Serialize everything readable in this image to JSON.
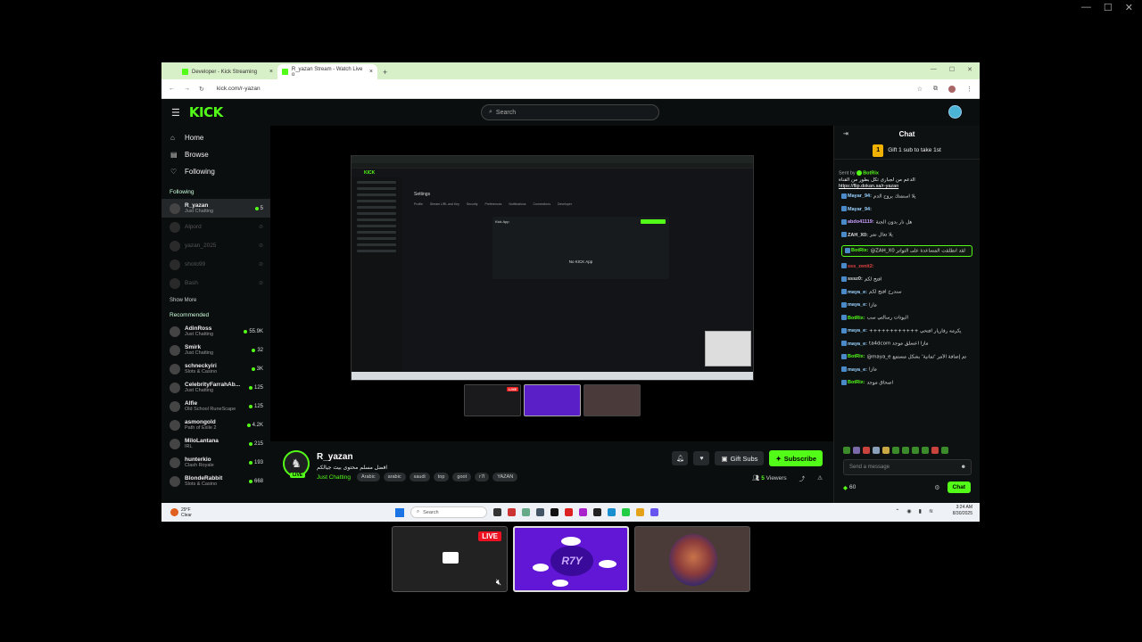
{
  "browser": {
    "tabs": [
      {
        "title": "Developer - Kick Streaming"
      },
      {
        "title": "R_yazan Stream - Watch Live o"
      }
    ],
    "url": "kick.com/r-yazan"
  },
  "kick": {
    "logo": "KICK",
    "search_placeholder": "Search",
    "nav": [
      {
        "label": "Home",
        "icon": "home-icon"
      },
      {
        "label": "Browse",
        "icon": "browse-icon"
      },
      {
        "label": "Following",
        "icon": "heart-icon"
      }
    ],
    "following_title": "Following",
    "following": [
      {
        "name": "R_yazan",
        "category": "Just Chatting",
        "viewers": "5",
        "live": true
      },
      {
        "name": "Alpord",
        "category": "",
        "viewers": "",
        "live": false
      },
      {
        "name": "yazan_2025",
        "category": "",
        "viewers": "",
        "live": false
      },
      {
        "name": "shoto99",
        "category": "",
        "viewers": "",
        "live": false
      },
      {
        "name": "Bash",
        "category": "",
        "viewers": "",
        "live": false
      }
    ],
    "show_more": "Show More",
    "recommended_title": "Recommended",
    "recommended": [
      {
        "name": "AdinRoss",
        "category": "Just Chatting",
        "viewers": "55.9K"
      },
      {
        "name": "Smirk",
        "category": "Just Chatting",
        "viewers": "32"
      },
      {
        "name": "schneckyiri",
        "category": "Slots & Casino",
        "viewers": "3K"
      },
      {
        "name": "CelebrityFarrahAb...",
        "category": "Just Chatting",
        "viewers": "125"
      },
      {
        "name": "Alfie",
        "category": "Old School RuneScape",
        "viewers": "125"
      },
      {
        "name": "asmongold",
        "category": "Path of Exile 2",
        "viewers": "4.2K"
      },
      {
        "name": "MiloLantana",
        "category": "IRL",
        "viewers": "215"
      },
      {
        "name": "hunterkio",
        "category": "Clash Royale",
        "viewers": "193"
      },
      {
        "name": "BlondeRabbit",
        "category": "Slots & Casino",
        "viewers": "668"
      }
    ]
  },
  "player": {
    "nested_title": "Settings",
    "nested_tabs": [
      "Profile",
      "Stream URL and Key",
      "Security",
      "Preferences",
      "Notifications",
      "Connections",
      "Developer"
    ],
    "nested_panel_title": "Kick App",
    "nested_empty": "No KICK App",
    "thumb_live": "LIVE"
  },
  "stream": {
    "streamer": "R_yazan",
    "title": "افضل مسلم محتوى بيث جيالكم",
    "category": "Just Chatting",
    "tags": [
      "Arabic",
      "arabic",
      "saudi",
      "top",
      "goot",
      "r7l",
      "YAZAN"
    ],
    "live_label": "LIVE",
    "gift_label": "Gift Subs",
    "subscribe_label": "Subscribe",
    "viewers": "5",
    "viewers_label": "Viewers"
  },
  "chat": {
    "title": "Chat",
    "gift_banner": "Gift 1 sub to take 1st",
    "gift_count": "1",
    "pinned_by": "Sent by",
    "pinned_user": "BotRix",
    "pinned_text": "الدعم من لجبارى تكل بطور من القناة",
    "pinned_link": "https://flip.dokan.sa/r-yazan",
    "messages": [
      {
        "user": "Mayar_94:",
        "text": "يلا استمتك بروح الدم",
        "color": "#9ad2ff"
      },
      {
        "user": "Mayar_94:",
        "text": "",
        "color": "#9ad2ff"
      },
      {
        "user": "abdo41119:",
        "text": "هل نار بدون الجنة",
        "color": "#c9a0ff"
      },
      {
        "user": "ZAH_X0:",
        "text": "يلا تعال نمر",
        "color": "#ddd"
      },
      {
        "user": "BotRix:",
        "text": "@ZAH_X0 لقد انطلقت المساعدة على التواتر",
        "color": "#53fc18",
        "highlight": true
      },
      {
        "user": "sss_zenit2:",
        "text": "",
        "color": "#e04444"
      },
      {
        "user": "sssz0:",
        "text": "افتح لكم",
        "color": "#ddd"
      },
      {
        "user": "maya_e:",
        "text": "سندرخ افتح لكم",
        "color": "#9ad2ff"
      },
      {
        "user": "maya_e:",
        "text": "مازا",
        "color": "#9ad2ff"
      },
      {
        "user": "BotRix:",
        "text": "البوتات رسالتي سب",
        "color": "#53fc18"
      },
      {
        "user": "maya_e:",
        "text": "++++++++++++ يكرمه رفاريار افتحي",
        "color": "#9ad2ff"
      },
      {
        "user": "maya_e:",
        "text": "ta4dcom مازا اعسلق موجد",
        "color": "#9ad2ff"
      },
      {
        "user": "BotRix:",
        "text": "@maya_e تم إضافة الأمر 'ثمانية' بشكل مستمع",
        "color": "#53fc18"
      },
      {
        "user": "maya_e:",
        "text": "مازا",
        "color": "#9ad2ff"
      },
      {
        "user": "BotRix:",
        "text": "اصحاق موجد",
        "color": "#53fc18"
      }
    ],
    "input_placeholder": "Send a message",
    "points": "60",
    "chat_button": "Chat"
  },
  "taskbar": {
    "weather_temp": "29°F",
    "weather_desc": "Clear",
    "search": "Search",
    "time": "3:24 AM",
    "date": "8/30/2025"
  },
  "picker": {
    "live_label": "LIVE"
  }
}
